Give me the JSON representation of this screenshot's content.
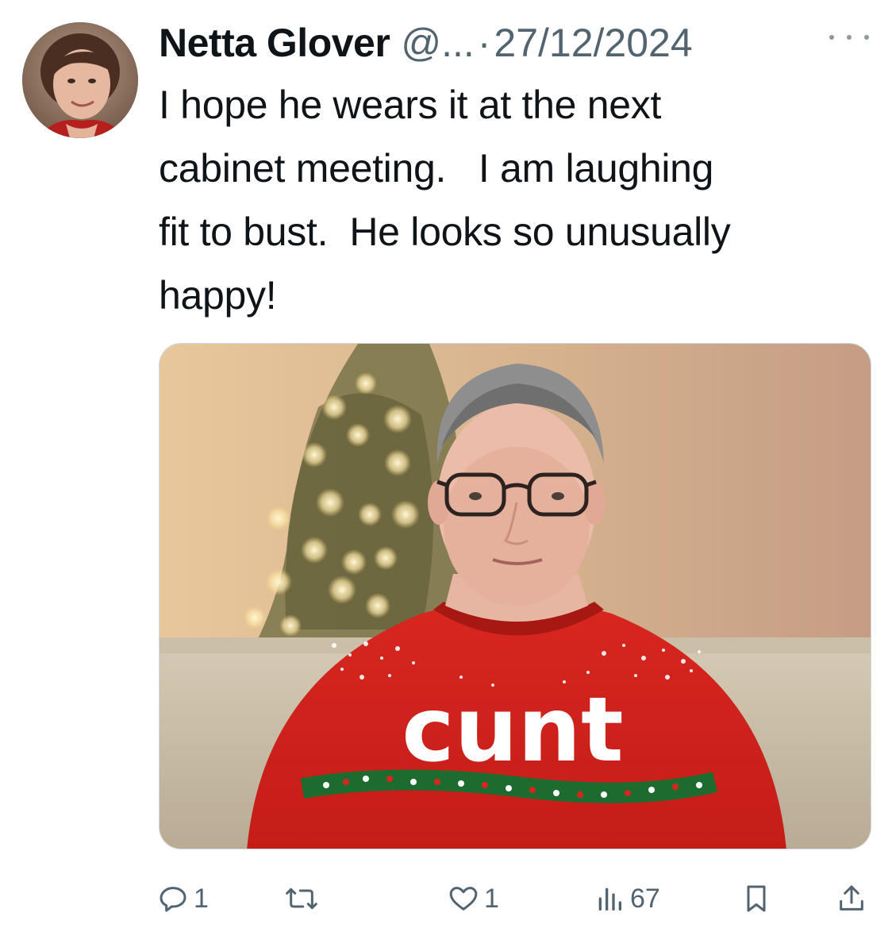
{
  "tweet": {
    "author_name": "Netta Glover",
    "author_handle": "@...",
    "separator": "·",
    "date": "27/12/2024",
    "text": "I hope he wears it at the next\ncabinet meeting.   I am laughing\nfit to bust.  He looks so unusually\nhappy!",
    "media": {
      "sweater_text": "cunt"
    },
    "actions": {
      "reply_count": "1",
      "retweet_count": "",
      "like_count": "1",
      "views_count": "67"
    }
  },
  "icons": {
    "avatar": "avatar-photo",
    "more": "more-horizontal-icon",
    "reply": "reply-icon",
    "retweet": "retweet-icon",
    "like": "heart-icon",
    "views": "views-bar-chart-icon",
    "bookmark": "bookmark-icon",
    "share": "share-icon"
  },
  "colors": {
    "text_primary": "#0f1419",
    "text_secondary": "#536471",
    "sweater_red": "#d8261f",
    "border": "#cfd9de"
  }
}
